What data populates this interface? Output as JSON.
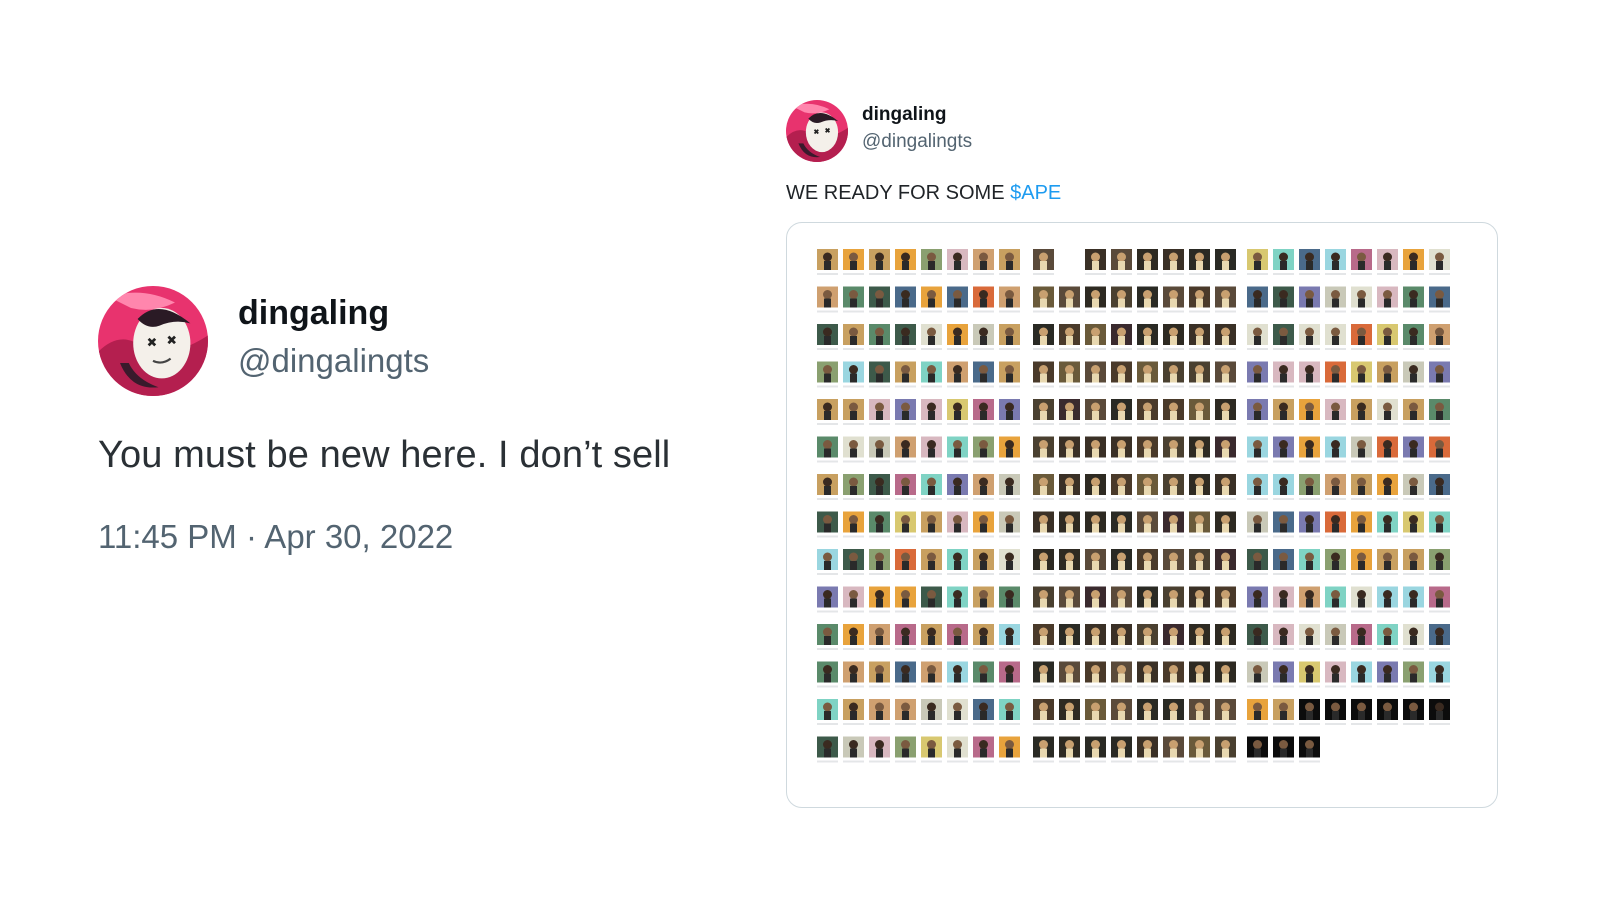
{
  "left_tweet": {
    "display_name": "dingaling",
    "handle": "@dingalingts",
    "text": "You must be new here. I don’t sell",
    "timestamp": "11:45 PM · Apr 30, 2022",
    "avatar_icon": "pfp-avatar-icon"
  },
  "right_tweet": {
    "display_name": "dingaling",
    "handle": "@dingalingts",
    "text_prefix": "WE READY FOR SOME ",
    "cashtag": "$APE",
    "avatar_icon": "pfp-avatar-icon",
    "media": {
      "description_icon": "nft-collection-grid-icon",
      "groups": [
        {
          "rows": 14,
          "cols": 8,
          "palette": "mixed"
        },
        {
          "rows": 14,
          "cols": 8,
          "palette": "dark"
        },
        {
          "rows": 14,
          "cols": 8,
          "palette": "mixed"
        }
      ]
    }
  },
  "colors": {
    "link": "#1d9bf0",
    "secondary_text": "#536471",
    "avatar_pink": "#e8336e"
  }
}
